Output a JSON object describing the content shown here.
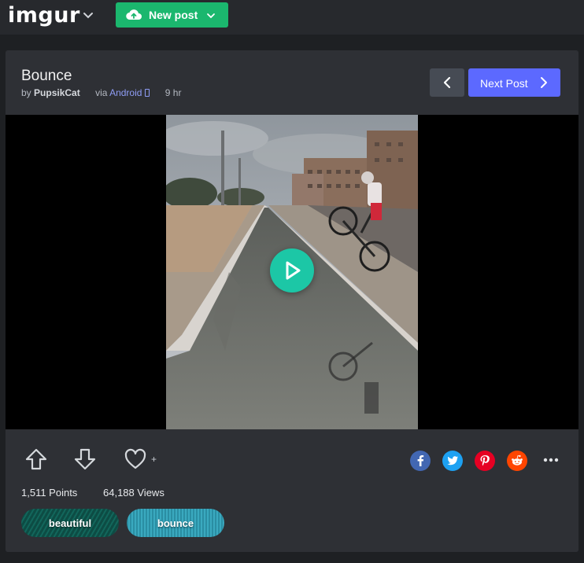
{
  "topbar": {
    "logo": "imgur",
    "new_post_label": "New post"
  },
  "post": {
    "title": "Bounce",
    "by_prefix": "by",
    "author": "PupsikCat",
    "via_prefix": "via",
    "platform": "Android",
    "time_ago": "9 hr"
  },
  "nav": {
    "next_label": "Next Post"
  },
  "stats": {
    "points": "1,511 Points",
    "views": "64,188 Views"
  },
  "actions": {
    "favorite_plus": "+"
  },
  "tags": [
    {
      "label": "beautiful"
    },
    {
      "label": "bounce"
    }
  ],
  "colors": {
    "brand_green": "#1bb76e",
    "next_post_blue": "#5c69ff",
    "play_teal": "#1cc7a6",
    "facebook": "#4267b2",
    "twitter": "#1da1f2",
    "pinterest": "#e60023",
    "reddit": "#ff4500"
  },
  "icons": [
    "chevron-down-icon",
    "upload-cloud-icon",
    "chevron-left-icon",
    "chevron-right-icon",
    "play-icon",
    "upvote-icon",
    "downvote-icon",
    "heart-icon",
    "facebook-icon",
    "twitter-icon",
    "pinterest-icon",
    "reddit-icon",
    "more-icon"
  ]
}
